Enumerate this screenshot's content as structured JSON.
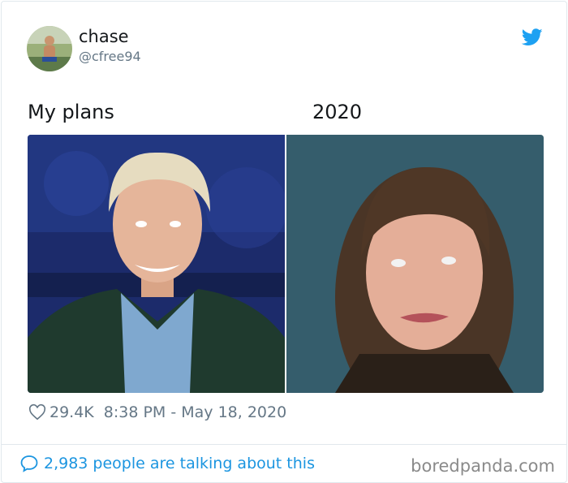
{
  "tweet": {
    "name": "chase",
    "handle": "@cfree94",
    "caption_left": "My plans",
    "caption_right": "2020",
    "likes": "29.4K",
    "timestamp": "8:38 PM - May 18, 2020",
    "talking": "2,983 people are talking about this"
  },
  "watermark": "boredpanda.com",
  "icons": {
    "platform": "twitter-bird-icon",
    "like": "heart-outline-icon",
    "reply": "speech-bubble-icon"
  },
  "colors": {
    "accent": "#1b95e0",
    "bird": "#1da1f2",
    "muted": "#657786",
    "text": "#14171a"
  }
}
